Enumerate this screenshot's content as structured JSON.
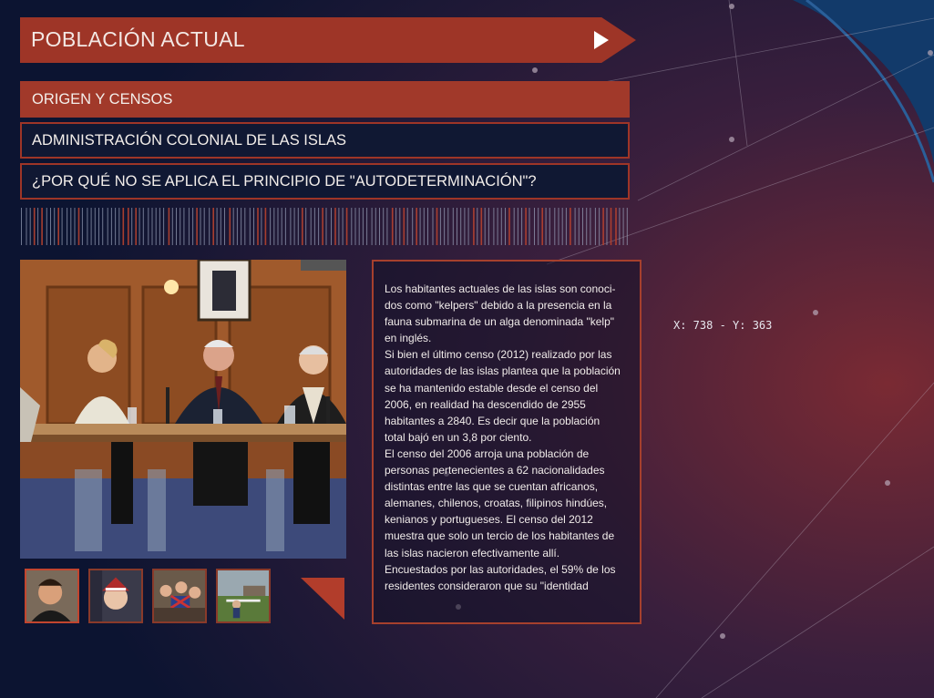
{
  "header": {
    "title": "POBLACIÓN ACTUAL"
  },
  "menu": {
    "items": [
      {
        "label": "ORIGEN Y CENSOS",
        "active": true
      },
      {
        "label": "ADMINISTRACIÓN COLONIAL DE LAS ISLAS",
        "active": false
      },
      {
        "label": "¿POR QUÉ NO SE APLICA EL PRINCIPIO DE \"AUTODETERMINACIÓN\"?",
        "active": false
      }
    ]
  },
  "article": {
    "paragraphs": [
      "Los habitantes actuales de las islas son conoci-dos como \"kelpers\" debido a la presencia en la fauna submarina de un alga denominada \"kelp\" en inglés.",
      "Si bien el último censo (2012) realizado por las autoridades de las islas plantea que la población se ha mantenido estable desde el censo del 2006, en realidad ha descendido de 2955 habitantes a 2840. Es decir que la población total bajó en un 3,8 por ciento.",
      "El censo del 2006 arroja una población de personas pertenecientes a 62 nacionalidades distintas entre las que se cuentan africanos, alemanes, chilenos, croatas, filipinos hindúes, kenianos y portugueses. El censo del 2012 muestra que solo un tercio de los habitantes de las islas nacieron efectivamente allí.",
      "Encuestados por las autoridades, el 59% de los residentes consideraron que su \"identidad"
    ]
  },
  "gallery": {
    "thumbnails": 4,
    "selected_index": 0
  },
  "status": {
    "coords": "X: 738 - Y: 363"
  },
  "colors": {
    "accent": "#9e3527",
    "background": "#0d1530"
  }
}
